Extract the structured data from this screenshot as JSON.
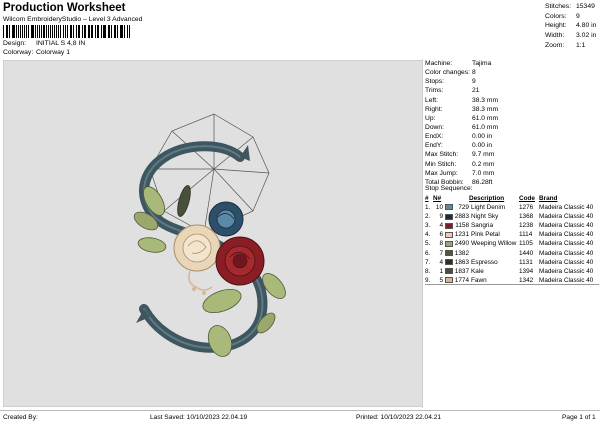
{
  "header": {
    "title": "Production Worksheet",
    "subtitle": "Wilcom EmbroideryStudio – Level 3 Advanced",
    "design_label": "Design:",
    "design_value": "INITIAL S 4,8 IN",
    "colorway_label": "Colorway:",
    "colorway_value": "Colorway 1"
  },
  "top_stats": [
    {
      "label": "Stitches:",
      "value": "15349"
    },
    {
      "label": "Colors:",
      "value": "9"
    },
    {
      "label": "Height:",
      "value": "4.80 in"
    },
    {
      "label": "Width:",
      "value": "3.02 in"
    },
    {
      "label": "Zoom:",
      "value": "1:1"
    }
  ],
  "machine_info": [
    {
      "label": "Machine:",
      "value": "Tajima"
    },
    {
      "label": "Color changes:",
      "value": "8"
    },
    {
      "label": "Stops:",
      "value": "9"
    },
    {
      "label": "Trims:",
      "value": "21"
    },
    {
      "label": "Left:",
      "value": "38.3 mm"
    },
    {
      "label": "Right:",
      "value": "38.3 mm"
    },
    {
      "label": "Up:",
      "value": "61.0 mm"
    },
    {
      "label": "Down:",
      "value": "61.0 mm"
    },
    {
      "label": "EndX:",
      "value": "0.00 in"
    },
    {
      "label": "EndY:",
      "value": "0.00 in"
    },
    {
      "label": "Max Stitch:",
      "value": "9.7 mm"
    },
    {
      "label": "Min Stitch:",
      "value": "0.2 mm"
    },
    {
      "label": "Max Jump:",
      "value": "7.0 mm"
    },
    {
      "label": "Total Bobbin:",
      "value": "86.28ft"
    }
  ],
  "stop_sequence": {
    "label": "Stop Sequence:",
    "headers": {
      "num": "#",
      "n": "N#",
      "description": "Description",
      "code": "Code",
      "brand": "Brand"
    },
    "rows": [
      {
        "num": "1.",
        "n": "10",
        "thread": "729",
        "description": "Light Denim",
        "code": "1276",
        "brand": "Madeira Classic 40",
        "color": "#5b8aa6"
      },
      {
        "num": "2.",
        "n": "9",
        "thread": "2883",
        "description": "Night Sky",
        "code": "1368",
        "brand": "Madeira Classic 40",
        "color": "#1d2a3a"
      },
      {
        "num": "3.",
        "n": "4",
        "thread": "1158",
        "description": "Sangria",
        "code": "1238",
        "brand": "Madeira Classic 40",
        "color": "#7a1f26"
      },
      {
        "num": "4.",
        "n": "6",
        "thread": "1231",
        "description": "Pink Petal",
        "code": "1114",
        "brand": "Madeira Classic 40",
        "color": "#f0c8c0"
      },
      {
        "num": "5.",
        "n": "8",
        "thread": "2490",
        "description": "Weeping Willow",
        "code": "1105",
        "brand": "Madeira Classic 40",
        "color": "#9aa86c"
      },
      {
        "num": "6.",
        "n": "7",
        "thread": "1382",
        "description": "",
        "code": "1440",
        "brand": "Madeira Classic 40",
        "color": "#4d5a3a"
      },
      {
        "num": "7.",
        "n": "4",
        "thread": "1863",
        "description": "Espresso",
        "code": "1131",
        "brand": "Madeira Classic 40",
        "color": "#3b2a22"
      },
      {
        "num": "8.",
        "n": "1",
        "thread": "1837",
        "description": "Kale",
        "code": "1394",
        "brand": "Madeira Classic 40",
        "color": "#46503a"
      },
      {
        "num": "9.",
        "n": "5",
        "thread": "1774",
        "description": "Fawn",
        "code": "1342",
        "brand": "Madeira Classic 40",
        "color": "#d6b896"
      }
    ]
  },
  "footer": {
    "created_by": "Created By:",
    "last_saved": "Last Saved: 10/10/2023 22.04.19",
    "printed": "Printed: 10/10/2023 22.04.21",
    "page": "Page 1 of 1"
  },
  "colors": {
    "canvas_bg": "#e0e0e0",
    "letter_s": "#3e5660",
    "rose_red": "#8a1e24",
    "rose_cream": "#e9d6b8",
    "rose_blue": "#2c4f6a",
    "leaf_green": "#a9b97a"
  }
}
